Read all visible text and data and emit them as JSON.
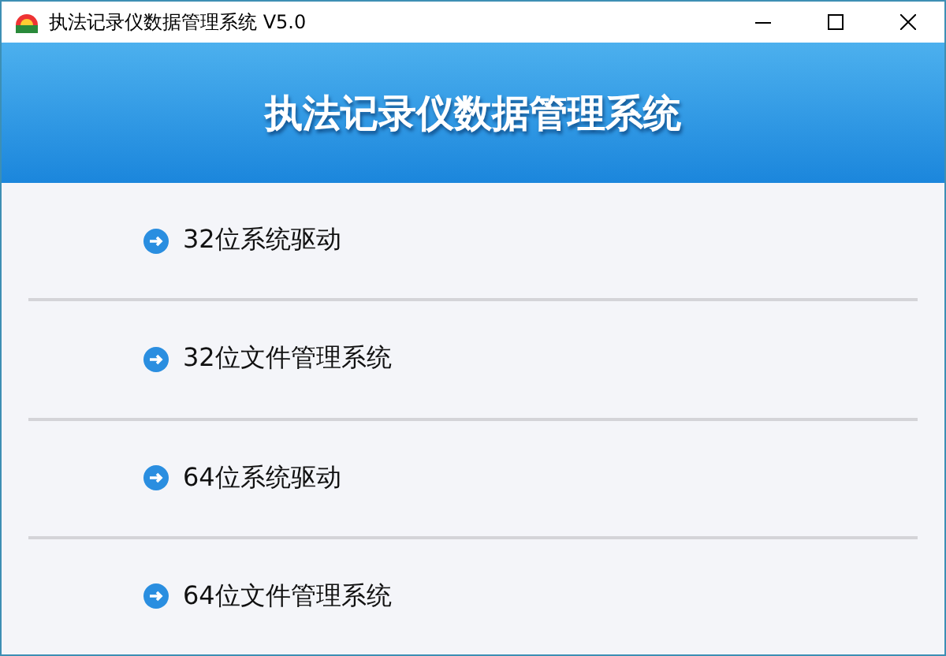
{
  "window": {
    "title": "执法记录仪数据管理系统 V5.0"
  },
  "header": {
    "title": "执法记录仪数据管理系统"
  },
  "items": [
    {
      "label": "32位系统驱动"
    },
    {
      "label": "32位文件管理系统"
    },
    {
      "label": "64位系统驱动"
    },
    {
      "label": "64位文件管理系统"
    }
  ]
}
